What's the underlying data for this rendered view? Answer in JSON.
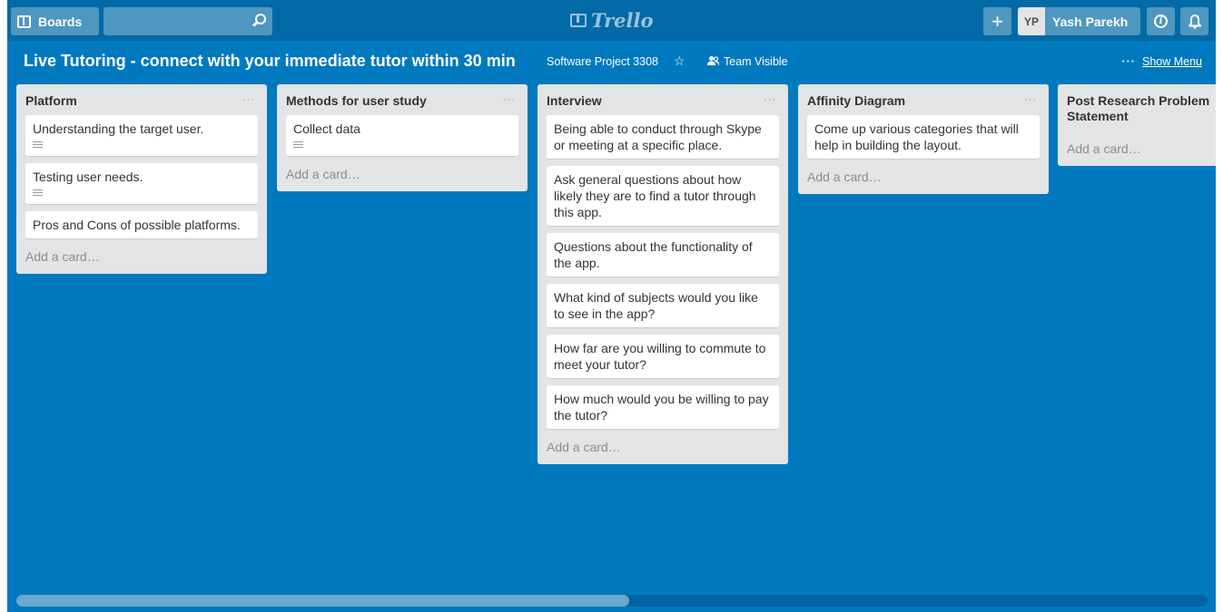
{
  "header": {
    "boards_label": "Boards",
    "search_placeholder": "",
    "logo_text": "Trello",
    "add_label": "+",
    "user_initials": "YP",
    "user_name": "Yash Parekh"
  },
  "board": {
    "title": "Live Tutoring - connect with your immediate tutor within 30 min",
    "organization": "Software Project 3308",
    "visibility": "Team Visible",
    "menu_dots": "···",
    "show_menu": "Show Menu"
  },
  "lists": [
    {
      "title": "Platform",
      "menu": "···",
      "cards": [
        {
          "text": "Understanding the target user.",
          "has_description": true
        },
        {
          "text": "Testing user needs.",
          "has_description": true
        },
        {
          "text": "Pros and Cons of possible platforms.",
          "has_description": false
        }
      ],
      "add_card": "Add a card…"
    },
    {
      "title": "Methods for user study",
      "menu": "···",
      "cards": [
        {
          "text": "Collect data",
          "has_description": true
        }
      ],
      "add_card": "Add a card…"
    },
    {
      "title": "Interview",
      "menu": "···",
      "cards": [
        {
          "text": "Being able to conduct through Skype or meeting at a specific place.",
          "has_description": false
        },
        {
          "text": "Ask general questions about how likely they are to find a tutor through this app.",
          "has_description": false
        },
        {
          "text": "Questions about the functionality of the app.",
          "has_description": false
        },
        {
          "text": "What kind of subjects would you like to see in the app?",
          "has_description": false
        },
        {
          "text": "How far are you willing to commute to meet your tutor?",
          "has_description": false
        },
        {
          "text": "How much would you be willing to pay the tutor?",
          "has_description": false
        }
      ],
      "add_card": "Add a card…"
    },
    {
      "title": "Affinity Diagram",
      "menu": "···",
      "cards": [
        {
          "text": "Come up various categories that will help in building the layout.",
          "has_description": false
        }
      ],
      "add_card": "Add a card…"
    },
    {
      "title": "Post Research Problem Statement",
      "menu": "",
      "cards": [],
      "add_card": "Add a card…"
    }
  ],
  "colors": {
    "board_background": "#0079bf",
    "header_background": "#026aa7",
    "list_background": "#e2e4e6",
    "card_background": "#ffffff"
  },
  "icons": [
    "boards-icon",
    "search-icon",
    "trello-logo-icon",
    "plus-icon",
    "info-icon",
    "bell-icon",
    "star-icon",
    "team-icon",
    "description-icon"
  ],
  "scroll": {
    "horizontal_position": 0.0,
    "visible_fraction": 0.51
  }
}
